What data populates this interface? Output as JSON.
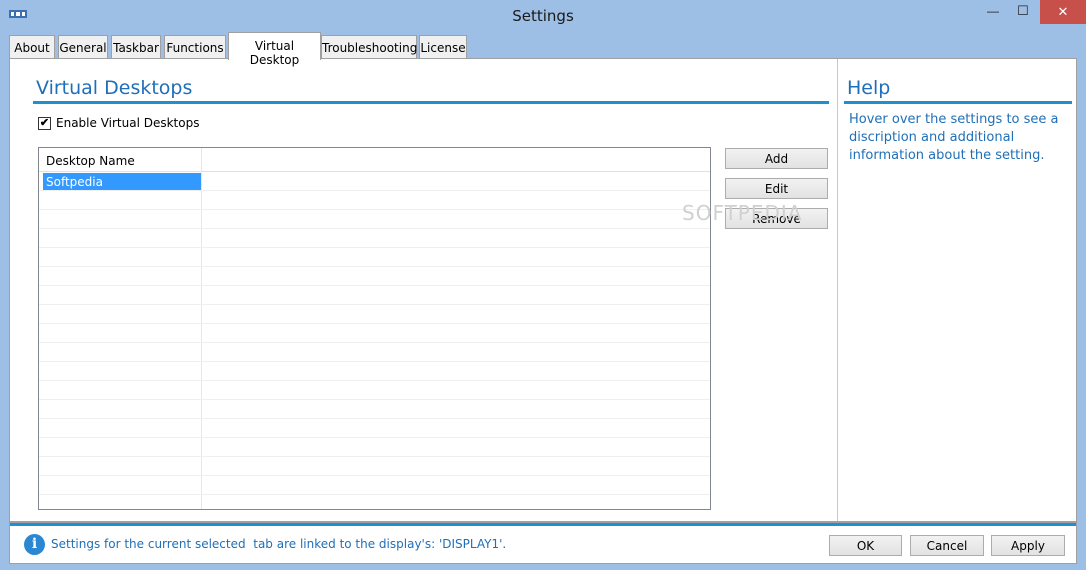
{
  "window": {
    "title": "Settings",
    "controls": {
      "min": "—",
      "max": "☐",
      "close": "✕"
    }
  },
  "tabs": [
    {
      "label": "About"
    },
    {
      "label": "General"
    },
    {
      "label": "Taskbar"
    },
    {
      "label": "Functions"
    },
    {
      "label": "Virtual Desktop",
      "active": true
    },
    {
      "label": "Troubleshooting"
    },
    {
      "label": "License"
    }
  ],
  "main": {
    "section_title": "Virtual Desktops",
    "enable_checkbox": {
      "label": "Enable Virtual Desktops",
      "checked": true,
      "mark": "✔"
    },
    "grid": {
      "column_header": "Desktop Name",
      "rows": [
        {
          "name": "Softpedia",
          "selected": true
        }
      ]
    },
    "buttons": {
      "add": "Add",
      "edit": "Edit",
      "remove": "Remove"
    }
  },
  "help": {
    "title": "Help",
    "text": "Hover over the settings to see a discription and additional information about the setting."
  },
  "status": {
    "icon": "info-icon",
    "text": "Settings for the current selected  tab are linked to the display's: 'DISPLAY1'."
  },
  "footer_buttons": {
    "ok": "OK",
    "cancel": "Cancel",
    "apply": "Apply"
  },
  "watermark": "SOFTPEDIA",
  "colors": {
    "accent": "#1e8fcf",
    "help_text": "#1f6fb8",
    "selection": "#3399ff",
    "frame": "#9dbfe6",
    "close": "#c7504a"
  }
}
